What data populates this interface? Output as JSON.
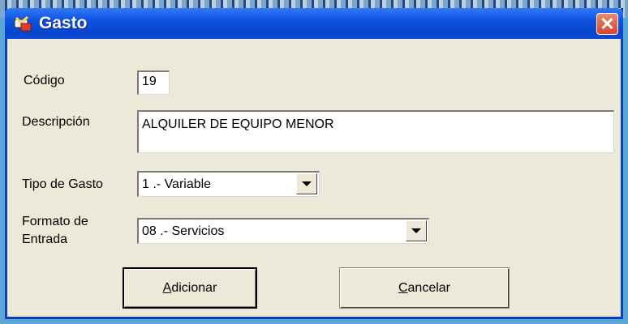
{
  "window": {
    "title": "Gasto"
  },
  "form": {
    "codigo_label": "Código",
    "codigo_value": "19",
    "descripcion_label": "Descripción",
    "descripcion_value": "ALQUILER DE EQUIPO MENOR",
    "tipo_label": "Tipo de Gasto",
    "tipo_value": "1 .- Variable",
    "formato_label_line1": "Formato de",
    "formato_label_line2": "Entrada",
    "formato_value": "08 .- Servicios"
  },
  "buttons": {
    "adicionar_underline": "A",
    "adicionar_rest": "dicionar",
    "cancelar_underline": "C",
    "cancelar_rest": "ancelar"
  },
  "icons": {
    "title_icon": "gasto-app-icon",
    "close_icon": "close-icon",
    "dropdown_icon": "chevron-down-icon"
  },
  "colors": {
    "titlebar": "#0845cf",
    "close": "#d6452a",
    "dialog_bg": "#ece9d8"
  }
}
